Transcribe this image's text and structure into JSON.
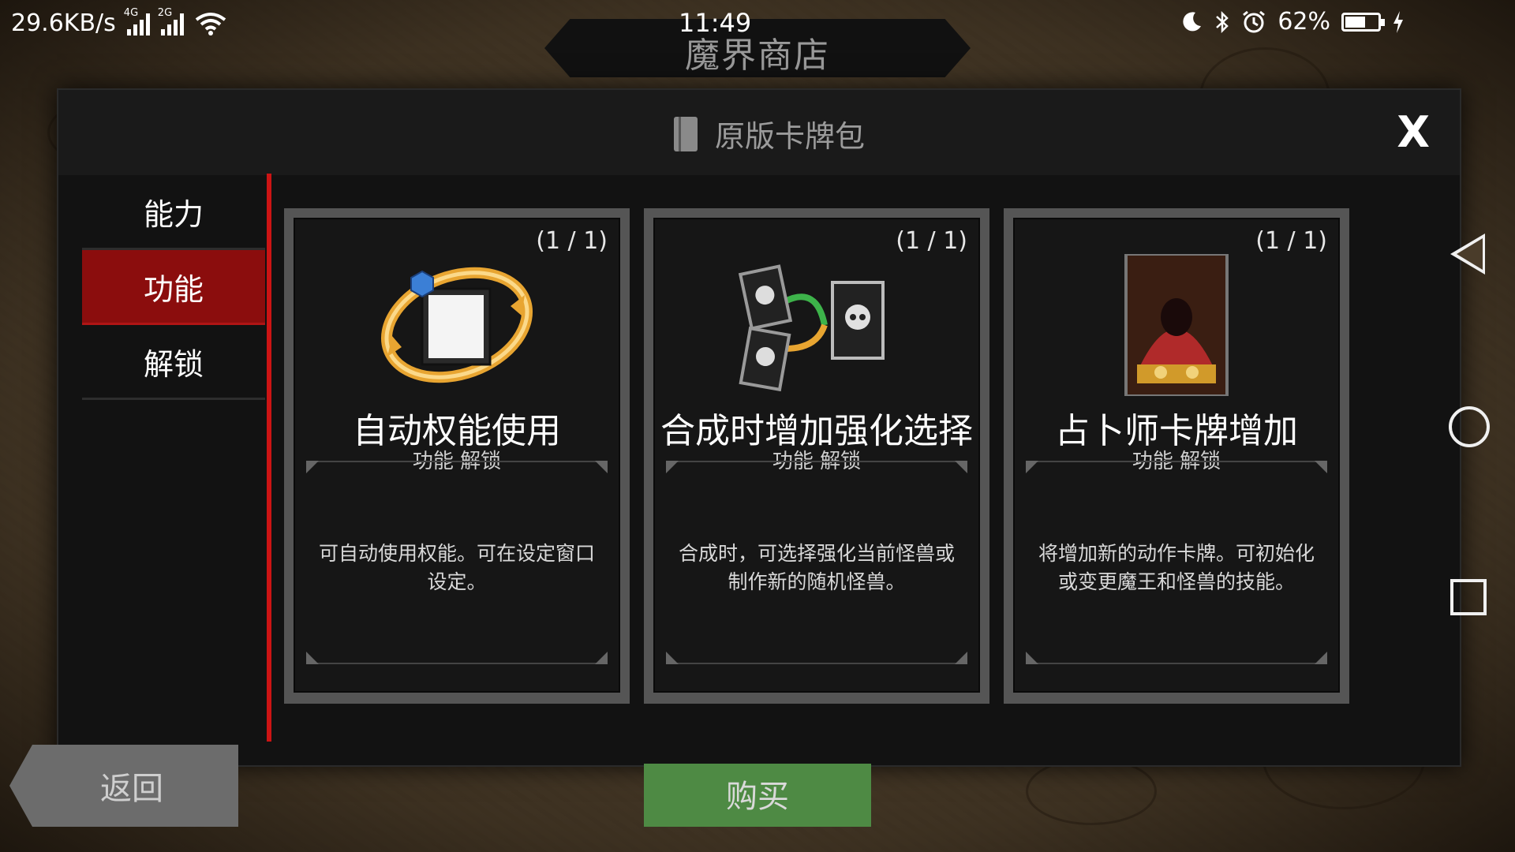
{
  "status_bar": {
    "net_speed": "29.6KB/s",
    "sig1_label": "4G",
    "sig2_label": "2G",
    "time": "11:49",
    "battery": "62%",
    "battery_level": 0.62
  },
  "banner": {
    "title": "魔界商店"
  },
  "modal": {
    "title": "原版卡牌包",
    "close_label": "X"
  },
  "sidebar": {
    "items": [
      {
        "label": "能力",
        "active": false
      },
      {
        "label": "功能",
        "active": true
      },
      {
        "label": "解锁",
        "active": false
      }
    ]
  },
  "cards": [
    {
      "count": "(1 / 1)",
      "title": "自动权能使用",
      "subtitle": "功能 解锁",
      "description": "可自动使用权能。可在设定窗口设定。",
      "art_icon": "auto-cycle-icon"
    },
    {
      "count": "(1 / 1)",
      "title": "合成时增加强化选择",
      "subtitle": "功能 解锁",
      "description": "合成时，可选择强化当前怪兽或制作新的随机怪兽。",
      "art_icon": "card-merge-icon"
    },
    {
      "count": "(1 / 1)",
      "title": "占卜师卡牌增加",
      "subtitle": "功能 解锁",
      "description": "将增加新的动作卡牌。可初始化或变更魔王和怪兽的技能。",
      "art_icon": "fortune-teller-portrait"
    }
  ],
  "buttons": {
    "back_label": "返回",
    "buy_label": "购买"
  },
  "colors": {
    "accent_red": "#cc1414",
    "active_tab": "#8b0d0d",
    "buy_green": "#4e8a44"
  }
}
